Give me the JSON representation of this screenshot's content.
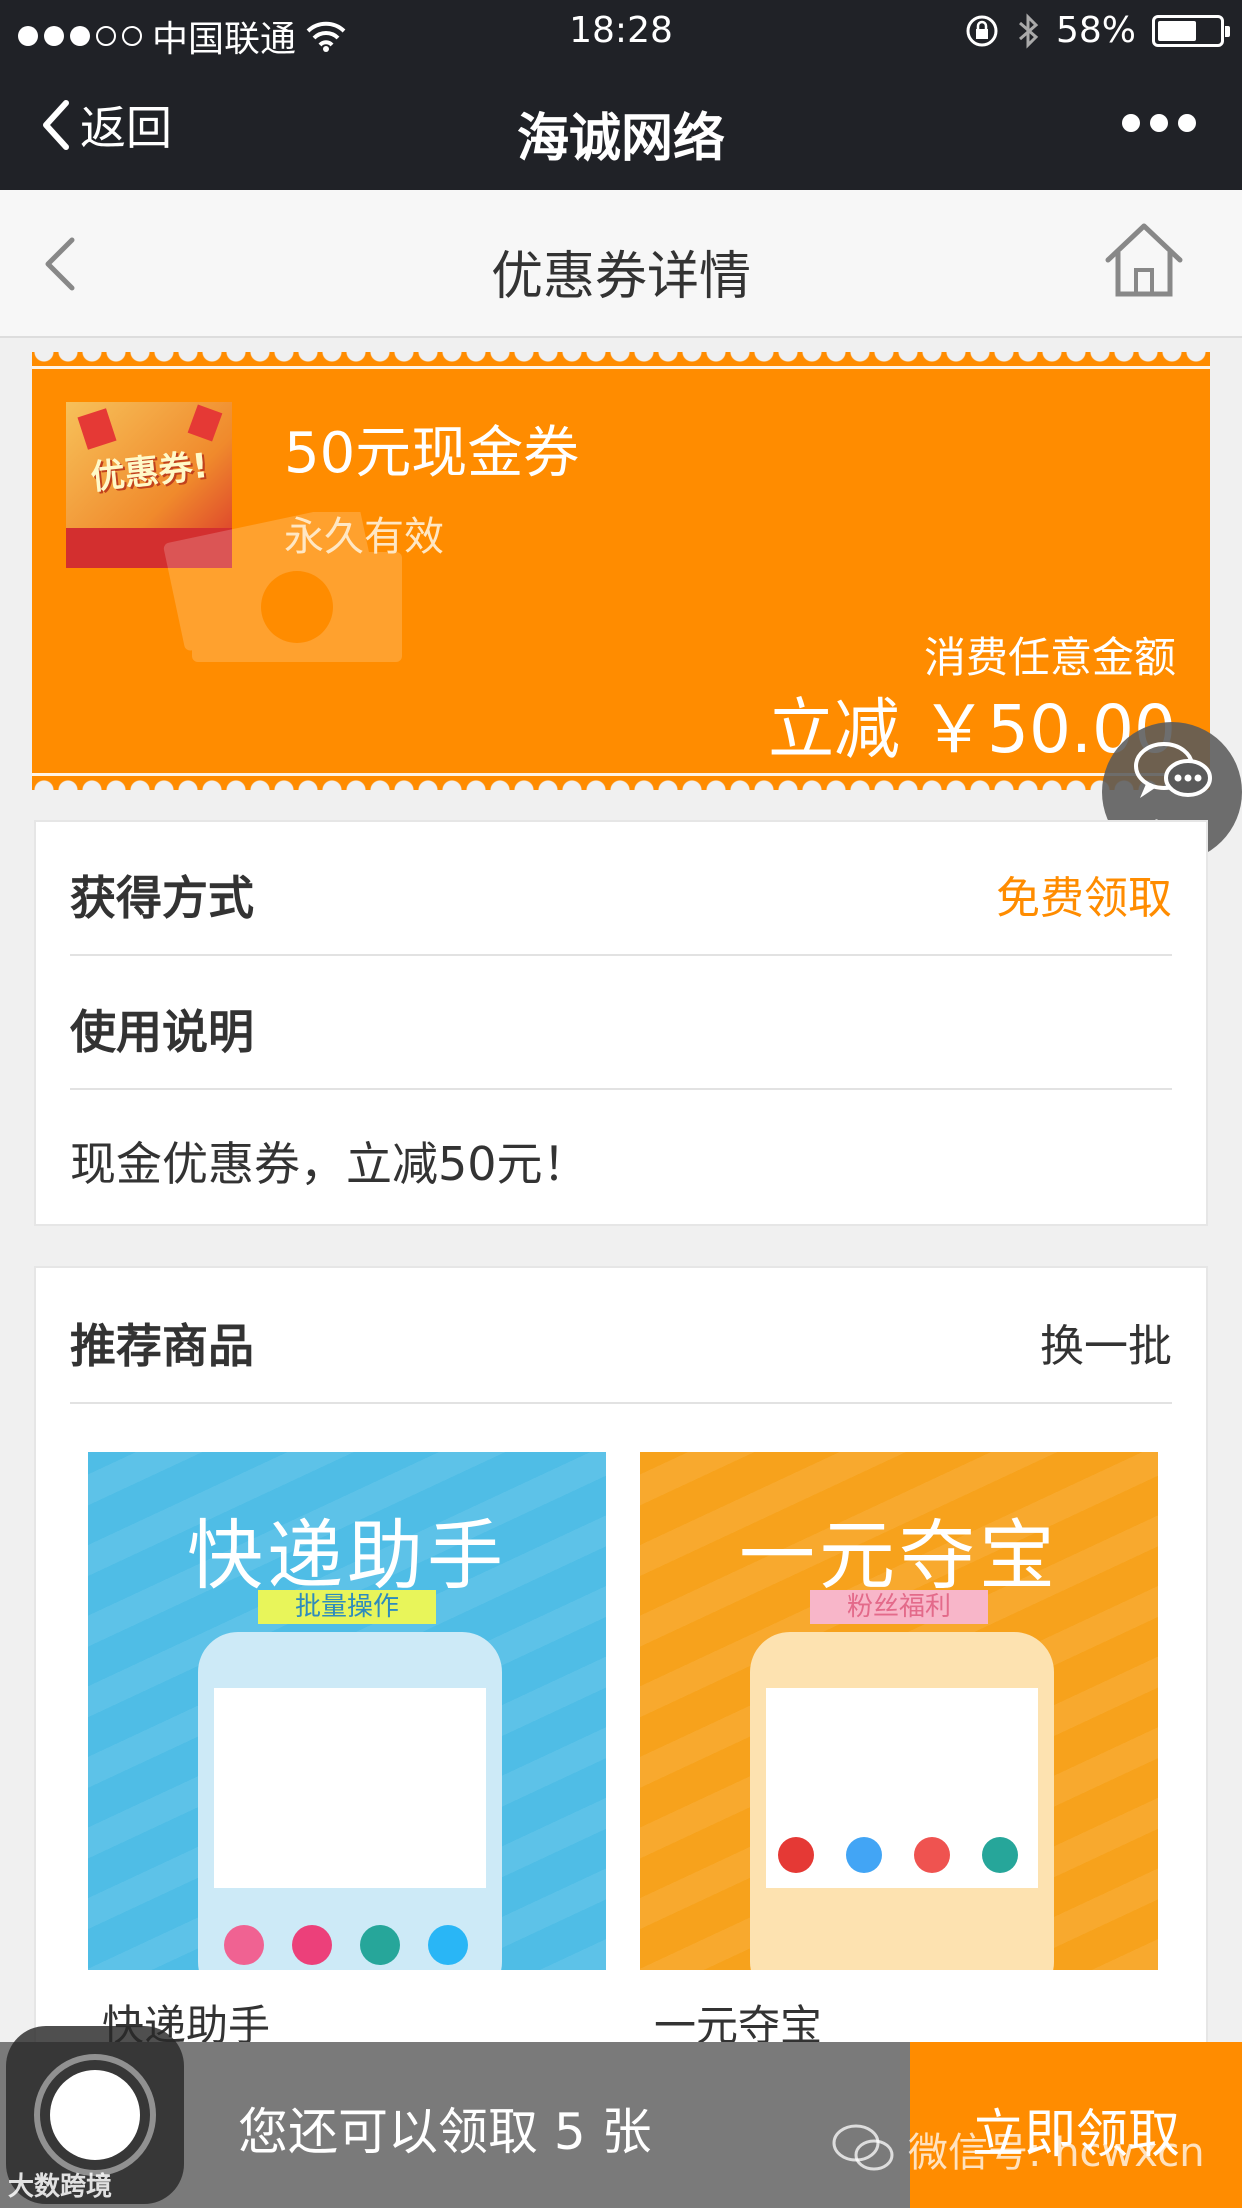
{
  "status_bar": {
    "carrier": "中国联通",
    "time": "18:28",
    "battery": "58%",
    "battery_level": 0.58
  },
  "wechat_bar": {
    "back_label": "返回",
    "title": "海诚网络"
  },
  "page_header": {
    "title": "优惠券详情"
  },
  "coupon": {
    "name": "50元现金券",
    "validity": "永久有效",
    "condition": "消费任意金额",
    "amount": "立减 ￥50.00",
    "thumb_text": "优惠券!",
    "colors": {
      "background": "#ff8c00"
    }
  },
  "customer_service": {
    "label": "客服"
  },
  "info": {
    "obtain_label": "获得方式",
    "obtain_value": "免费领取",
    "usage_label": "使用说明",
    "usage_text": "现金优惠券，立减50元！"
  },
  "recommend": {
    "title": "推荐商品",
    "refresh_label": "换一批",
    "products": [
      {
        "name": "快递助手",
        "image_title": "快递助手",
        "image_tag": "批量操作"
      },
      {
        "name": "一元夺宝",
        "image_title": "一元夺宝",
        "image_tag": "粉丝福利"
      }
    ]
  },
  "bottom_bar": {
    "remaining_text": "您还可以领取 5 张",
    "claim_label": "立即领取"
  },
  "watermarks": {
    "wechat_id": "微信号: hcwxcn",
    "corner": "大数跨境"
  }
}
